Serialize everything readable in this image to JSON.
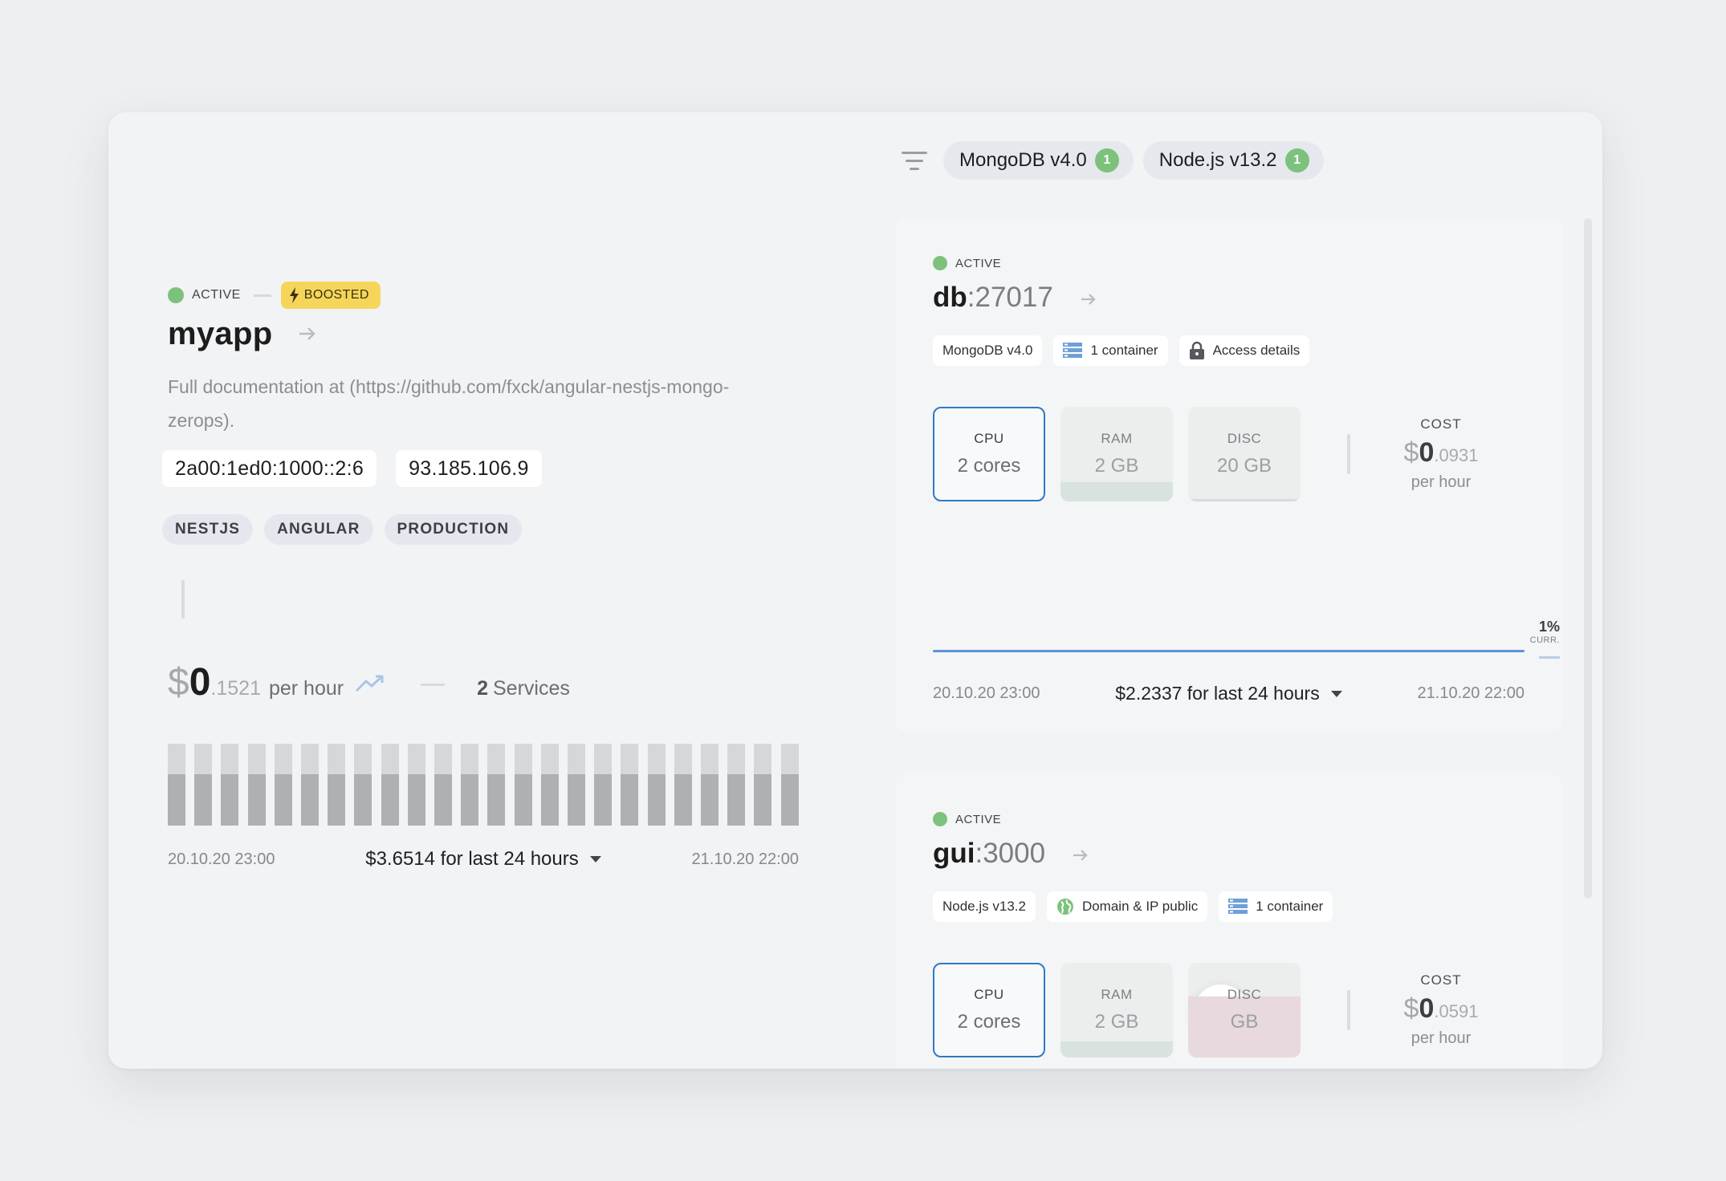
{
  "app": {
    "status": "ACTIVE",
    "badge": "BOOSTED",
    "name": "myapp",
    "description": "Full documentation at (https://github.com/fxck/angular-nestjs-mongo-zerops).",
    "ips": [
      "2a00:1ed0:1000::2:6",
      "93.185.106.9"
    ],
    "tags": [
      "NESTJS",
      "ANGULAR",
      "PRODUCTION"
    ],
    "cost": {
      "currency": "$",
      "integer": "0",
      "fraction": ".1521",
      "unit": "per hour"
    },
    "services": {
      "count": "2",
      "label": "Services"
    },
    "usage_bars": [
      0.63,
      0.63,
      0.63,
      0.63,
      0.63,
      0.63,
      0.63,
      0.63,
      0.63,
      0.63,
      0.63,
      0.63,
      0.63,
      0.63,
      0.63,
      0.63,
      0.63,
      0.63,
      0.63,
      0.63,
      0.63,
      0.63,
      0.63,
      0.63
    ],
    "timeline": {
      "start": "20.10.20 23:00",
      "summary": "$3.6514 for last 24 hours",
      "end": "21.10.20 22:00"
    }
  },
  "filters": [
    {
      "label": "MongoDB v4.0",
      "count": "1"
    },
    {
      "label": "Node.js v13.2",
      "count": "1"
    }
  ],
  "services": [
    {
      "status": "ACTIVE",
      "name": "db",
      "port": ":27017",
      "pills": [
        {
          "icon": "",
          "label": "MongoDB v4.0"
        },
        {
          "icon": "container-icon",
          "label": "1 container"
        },
        {
          "icon": "lock-icon",
          "label": "Access details"
        }
      ],
      "resources": [
        {
          "label": "CPU",
          "value": "2 cores"
        },
        {
          "label": "RAM",
          "value": "2 GB"
        },
        {
          "label": "DISC",
          "value": "20 GB"
        }
      ],
      "cost": {
        "label": "COST",
        "currency": "$",
        "integer": "0",
        "fraction": ".0931",
        "unit": "per hour"
      },
      "chart": {
        "percent": "1%",
        "current_label": "CURR."
      },
      "timeline": {
        "start": "20.10.20 23:00",
        "summary": "$2.2337 for last 24 hours",
        "end": "21.10.20 22:00"
      }
    },
    {
      "status": "ACTIVE",
      "name": "gui",
      "port": ":3000",
      "pills": [
        {
          "icon": "",
          "label": "Node.js v13.2"
        },
        {
          "icon": "globe-icon",
          "label": "Domain & IP public"
        },
        {
          "icon": "container-icon",
          "label": "1 container"
        }
      ],
      "resources": [
        {
          "label": "CPU",
          "value": "2 cores"
        },
        {
          "label": "RAM",
          "value": "2 GB"
        },
        {
          "label": "DISC",
          "value": "GB"
        }
      ],
      "cost": {
        "label": "COST",
        "currency": "$",
        "integer": "0",
        "fraction": ".0591",
        "unit": "per hour"
      }
    }
  ],
  "colors": {
    "active": "#7cc27d",
    "boosted": "#f5d65a",
    "accent": "#2f79c4",
    "chart_line": "#5a94d6"
  }
}
